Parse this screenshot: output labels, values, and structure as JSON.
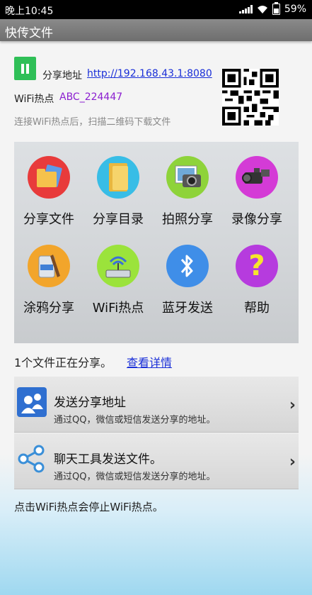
{
  "status_bar": {
    "time": "晚上10:45",
    "battery": "59%"
  },
  "app": {
    "title": "快传文件"
  },
  "share": {
    "label": "分享地址",
    "url": "http://192.168.43.1:8080",
    "wifi_label": "WiFi热点",
    "wifi_name": "ABC_224447",
    "hint": "连接WiFi热点后，扫描二维码下载文件"
  },
  "grid": [
    {
      "label": "分享文件",
      "icon": "share-files-icon",
      "color": "#e83b3b"
    },
    {
      "label": "分享目录",
      "icon": "folder-icon",
      "color": "#38bde6"
    },
    {
      "label": "拍照分享",
      "icon": "photo-icon",
      "color": "#8ed33a"
    },
    {
      "label": "录像分享",
      "icon": "video-camera-icon",
      "color": "#d43bd6"
    },
    {
      "label": "涂鸦分享",
      "icon": "paint-bucket-icon",
      "color": "#f2a52b"
    },
    {
      "label": "WiFi热点",
      "icon": "wifi-router-icon",
      "color": "#9be33b"
    },
    {
      "label": "蓝牙发送",
      "icon": "bluetooth-icon",
      "color": "#3f8ee8"
    },
    {
      "label": "帮助",
      "icon": "help-icon",
      "color": "#b63bde"
    }
  ],
  "status": {
    "count_text": "1个文件正在分享。",
    "details_link": "查看详情"
  },
  "list": [
    {
      "title": "发送分享地址",
      "subtitle": "通过QQ，微信或短信发送分享的地址。"
    },
    {
      "title": "聊天工具发送文件。",
      "subtitle": "通过QQ，微信或短信发送分享的地址。"
    }
  ],
  "footer": {
    "note": "点击WiFi热点会停止WiFi热点。"
  }
}
